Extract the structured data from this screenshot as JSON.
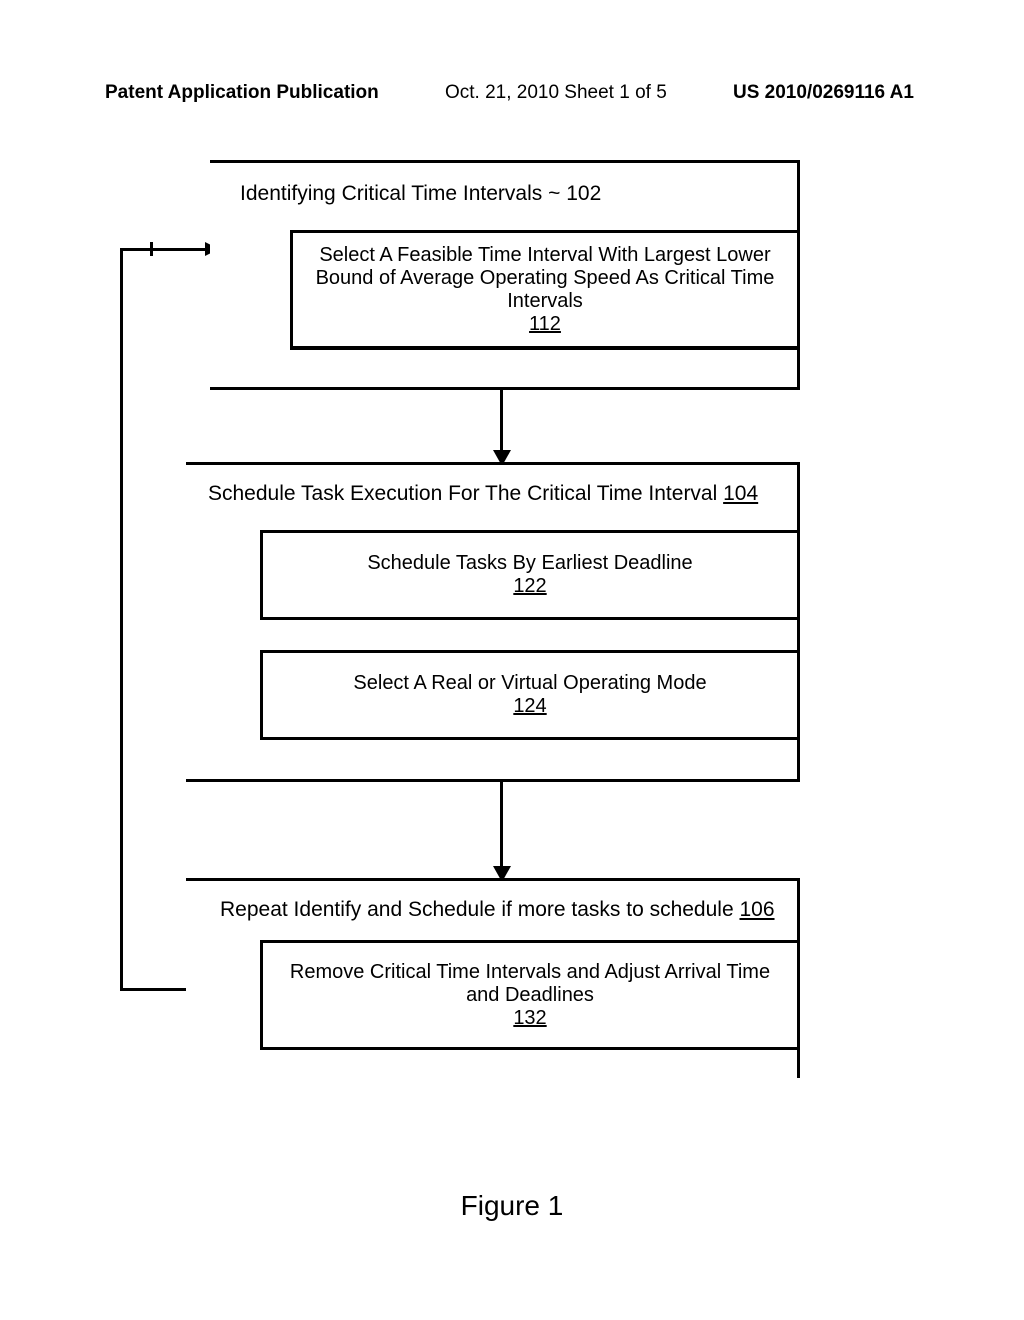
{
  "header": {
    "left": "Patent Application Publication",
    "mid": "Oct. 21, 2010  Sheet 1 of 5",
    "right": "US 2010/0269116 A1"
  },
  "box1": {
    "title": "Identifying Critical Time Intervals ~ 102",
    "inner_text": "Select A Feasible Time Interval With Largest Lower Bound of Average Operating Speed As Critical Time Intervals",
    "inner_ref": "112"
  },
  "box2": {
    "title_text": "Schedule Task Execution For The Critical Time Interval",
    "title_ref": "104",
    "inner1_text": "Schedule Tasks By Earliest Deadline",
    "inner1_ref": "122",
    "inner2_text": "Select A Real or Virtual Operating Mode",
    "inner2_ref": "124"
  },
  "box3": {
    "title_text": "Repeat Identify and Schedule if more tasks to schedule",
    "title_ref": "106",
    "inner_text": "Remove Critical Time Intervals and Adjust Arrival Time and Deadlines",
    "inner_ref": "132"
  },
  "figure_label": "Figure 1"
}
